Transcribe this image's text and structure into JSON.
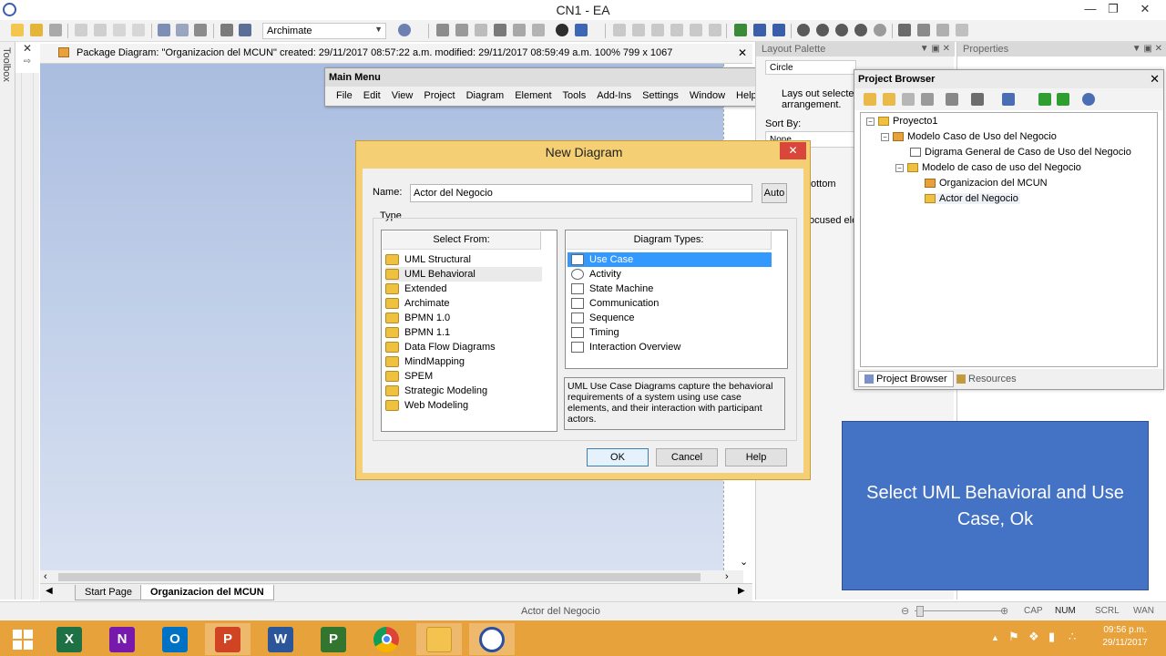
{
  "window": {
    "title": "CN1 - EA",
    "minimize_icon": "minimize-icon",
    "maximize_icon": "restore-icon",
    "close_icon": "close-icon"
  },
  "toolbar": {
    "combo_value": "Archimate"
  },
  "toolbox": {
    "label": "Toolbox"
  },
  "diagram_tab": {
    "text": "Package Diagram: \"Organizacion del MCUN\"   created: 29/11/2017 08:57:22 a.m.  modified: 29/11/2017 08:59:49 a.m.   100%   799 x 1067"
  },
  "main_menu": {
    "title": "Main Menu",
    "items": [
      "File",
      "Edit",
      "View",
      "Project",
      "Diagram",
      "Element",
      "Tools",
      "Add-Ins",
      "Settings",
      "Window",
      "Help"
    ]
  },
  "layout_palette": {
    "title": "Layout Palette",
    "circle_fragment": "Circle",
    "desc_line1": "Lays out selected",
    "desc_line2": "arrangement.",
    "sort_by": "Sort By:",
    "sort_value": "None",
    "bottom_fragment": "ottom",
    "focused_fragment": "ocused ele"
  },
  "properties": {
    "title": "Properties"
  },
  "project_browser": {
    "title": "Project Browser",
    "tree": [
      {
        "label": "Proyecto1"
      },
      {
        "label": "Modelo Caso de Uso del Negocio"
      },
      {
        "label": "Digrama General de Caso de Uso del Negocio"
      },
      {
        "label": "Modelo de caso de uso del Negocio"
      },
      {
        "label": "Organizacion del MCUN"
      },
      {
        "label": "Actor del Negocio"
      }
    ],
    "tabs": [
      "Project Browser",
      "Resources"
    ]
  },
  "dialog": {
    "title": "New Diagram",
    "name_label": "Name:",
    "name_value": "Actor del Negocio",
    "auto_label": "Auto",
    "type_label": "Type",
    "select_from_header": "Select From:",
    "select_from": [
      "UML Structural",
      "UML Behavioral",
      "Extended",
      "Archimate",
      "BPMN 1.0",
      "BPMN 1.1",
      "Data Flow Diagrams",
      "MindMapping",
      "SPEM",
      "Strategic Modeling",
      "Web Modeling"
    ],
    "diagram_types_header": "Diagram Types:",
    "diagram_types": [
      "Use Case",
      "Activity",
      "State Machine",
      "Communication",
      "Sequence",
      "Timing",
      "Interaction Overview"
    ],
    "description": "UML Use Case Diagrams capture the behavioral requirements of a system using use case elements, and their interaction with participant actors.",
    "ok_label": "OK",
    "cancel_label": "Cancel",
    "help_label": "Help"
  },
  "bottom_tabs": [
    "Start Page",
    "Organizacion del MCUN"
  ],
  "status": {
    "center": "Actor del Negocio",
    "indicators": [
      "CAP",
      "NUM",
      "SCRL",
      "WAN"
    ]
  },
  "callout": {
    "text": "Select UML Behavioral and Use Case, Ok"
  },
  "taskbar": {
    "time": "09:56 p.m.",
    "date": "29/11/2017"
  },
  "colors": {
    "dialog_frame": "#f5cf73",
    "selection": "#3399ff",
    "callout": "#4472c4",
    "taskbar": "#e8a23b"
  }
}
